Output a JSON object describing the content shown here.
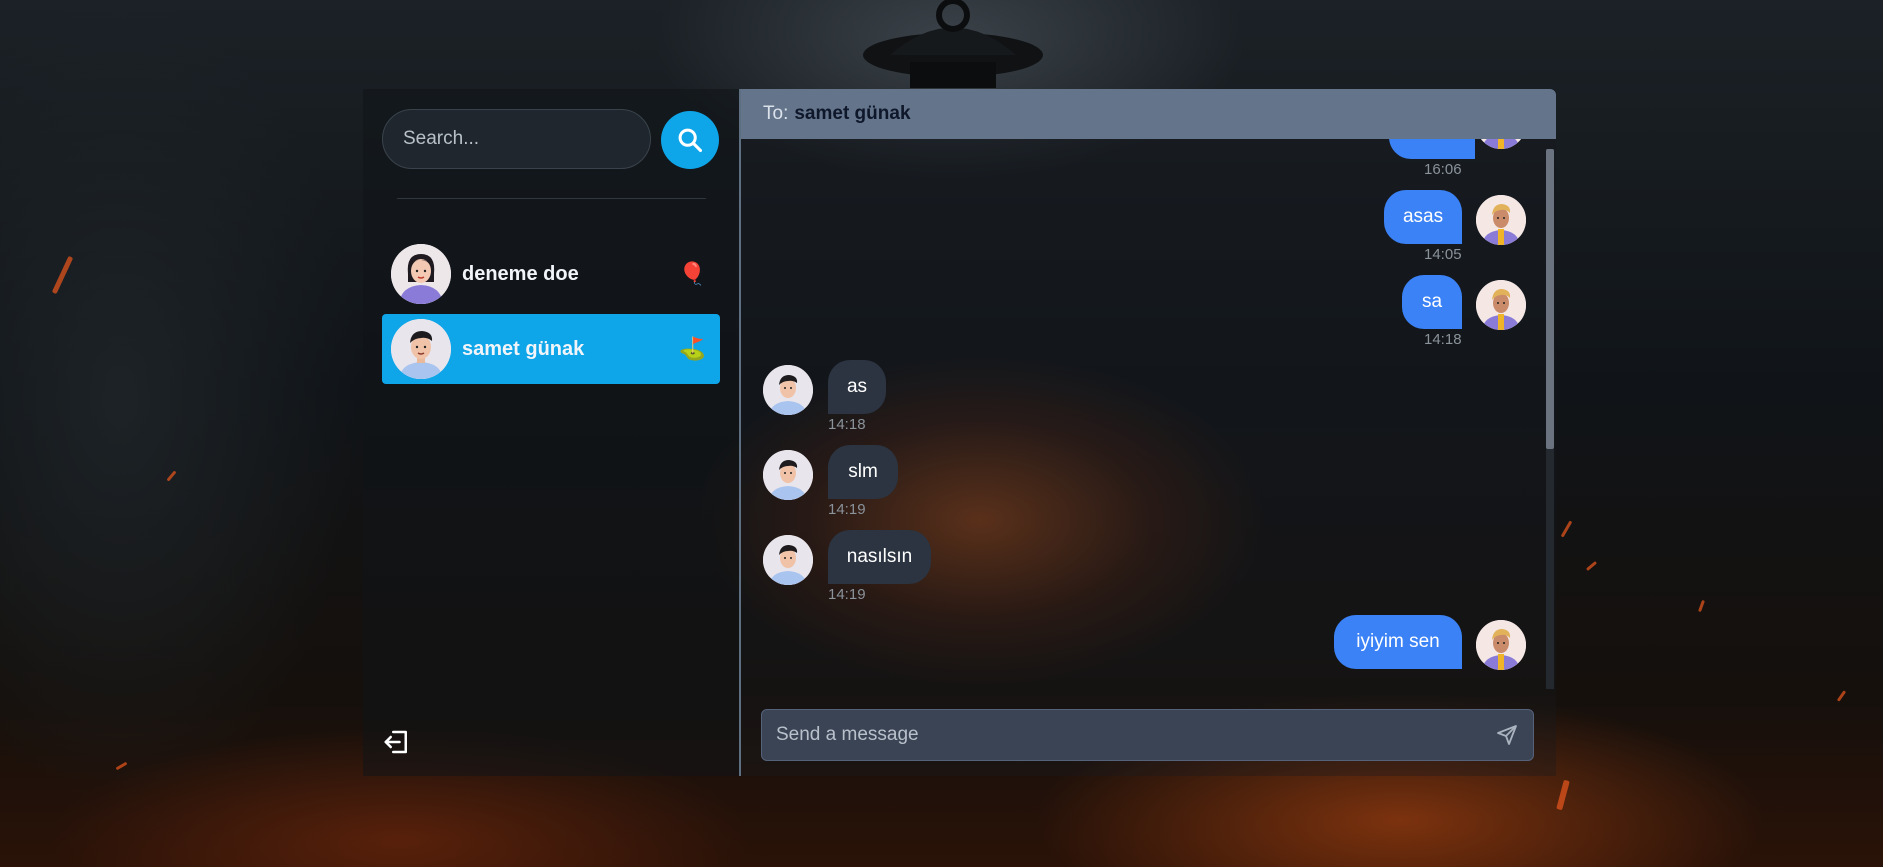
{
  "sidebar": {
    "search_placeholder": "Search...",
    "contacts": [
      {
        "name": "deneme doe",
        "emoji": "🎈",
        "active": false
      },
      {
        "name": "samet günak",
        "emoji": "⛳",
        "active": true
      }
    ]
  },
  "chat": {
    "to_label": "To:",
    "to_name": "samet günak",
    "composer_placeholder": "Send a message",
    "messages": [
      {
        "text": "",
        "time": "16:06",
        "direction": "out"
      },
      {
        "text": "asas",
        "time": "14:05",
        "direction": "out"
      },
      {
        "text": "sa",
        "time": "14:18",
        "direction": "out"
      },
      {
        "text": "as",
        "time": "14:18",
        "direction": "in"
      },
      {
        "text": "slm",
        "time": "14:19",
        "direction": "in"
      },
      {
        "text": "nasılsın",
        "time": "14:19",
        "direction": "in"
      },
      {
        "text": "iyiyim sen",
        "time": "",
        "direction": "out"
      }
    ]
  },
  "colors": {
    "accent": "#0ea5e9",
    "outgoing_bubble": "#3b82f6",
    "incoming_bubble": "#2b3440",
    "header": "#64748b"
  }
}
